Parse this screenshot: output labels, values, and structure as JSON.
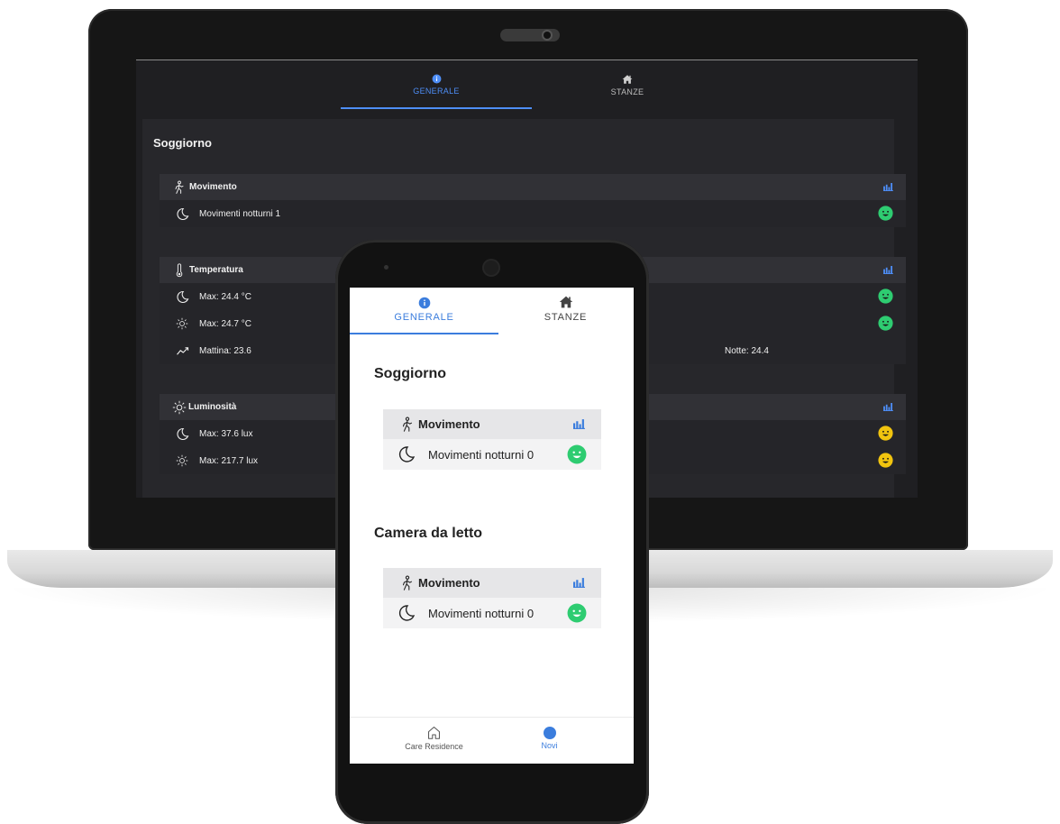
{
  "laptop": {
    "tabs": [
      {
        "label": "GENERALE",
        "icon": "info-icon",
        "active": true
      },
      {
        "label": "STANZE",
        "icon": "home-icon",
        "active": false
      }
    ],
    "room_title": "Soggiorno",
    "cards": [
      {
        "title": "Movimento",
        "icon": "walk-icon",
        "rows": [
          {
            "icon": "moon-icon",
            "text": "Movimenti notturni 1",
            "face": "happy",
            "face_color": "#2ecc71"
          }
        ]
      },
      {
        "title": "Temperatura",
        "icon": "thermometer-icon",
        "rows": [
          {
            "icon": "moon-icon",
            "text": "Max: 24.4 °C",
            "face": "happy",
            "face_color": "#2ecc71"
          },
          {
            "icon": "sun-icon",
            "text": "Max: 24.7 °C",
            "face": "happy",
            "face_color": "#2ecc71"
          },
          {
            "icon": "trend-icon",
            "text": "Mattina: 23.6",
            "extra": "Notte: 24.4"
          }
        ]
      },
      {
        "title": "Luminosità",
        "icon": "sun-icon",
        "rows": [
          {
            "icon": "moon-icon",
            "text": "Max: 37.6 lux",
            "face": "happy",
            "face_color": "#f1c40f"
          },
          {
            "icon": "sun-icon",
            "text": "Max: 217.7 lux",
            "face": "happy",
            "face_color": "#f1c40f"
          }
        ]
      }
    ]
  },
  "phone": {
    "tabs": [
      {
        "label": "GENERALE",
        "icon": "info-icon",
        "active": true
      },
      {
        "label": "STANZE",
        "icon": "home-icon",
        "active": false
      }
    ],
    "rooms": [
      {
        "title": "Soggiorno",
        "card": {
          "title": "Movimento",
          "icon": "walk-icon",
          "row_text": "Movimenti notturni 0",
          "face_color": "#2ecc71"
        }
      },
      {
        "title": "Camera da letto",
        "card": {
          "title": "Movimento",
          "icon": "walk-icon",
          "row_text": "Movimenti notturni 0",
          "face_color": "#2ecc71"
        }
      }
    ],
    "bottom_nav": [
      {
        "label": "Care Residence",
        "icon": "house-outline-icon",
        "active": false
      },
      {
        "label": "Novi",
        "icon": "dot-icon",
        "active": true
      }
    ]
  },
  "colors": {
    "accent": "#3b7ddd",
    "ok": "#2ecc71",
    "warn": "#f1c40f"
  }
}
